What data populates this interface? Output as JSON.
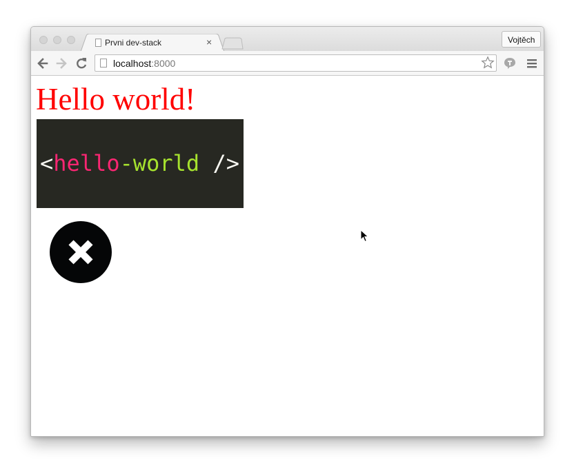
{
  "browser": {
    "tab_title": "Prvni dev-stack",
    "tab_close_glyph": "×",
    "profile_name": "Vojtěch",
    "url_host": "localhost",
    "url_port": ":8000",
    "icons": {
      "back": "back-arrow-icon",
      "forward": "forward-arrow-icon",
      "reload": "reload-icon",
      "page": "page-icon",
      "star": "bookmark-star-icon",
      "extension": "extension-icon",
      "menu": "hamburger-menu-icon"
    }
  },
  "page": {
    "heading": "Hello world!",
    "heading_color": "#ff0000",
    "code": {
      "open": "<",
      "word1": "hello",
      "dash": "-",
      "word2": "world",
      "close": " />",
      "background": "#272822",
      "color_bracket": "#f8f8f2",
      "color_word1": "#f92672",
      "color_word2": "#a6e22e"
    },
    "close_button": {
      "icon": "close-x-icon",
      "background": "#050607"
    }
  }
}
